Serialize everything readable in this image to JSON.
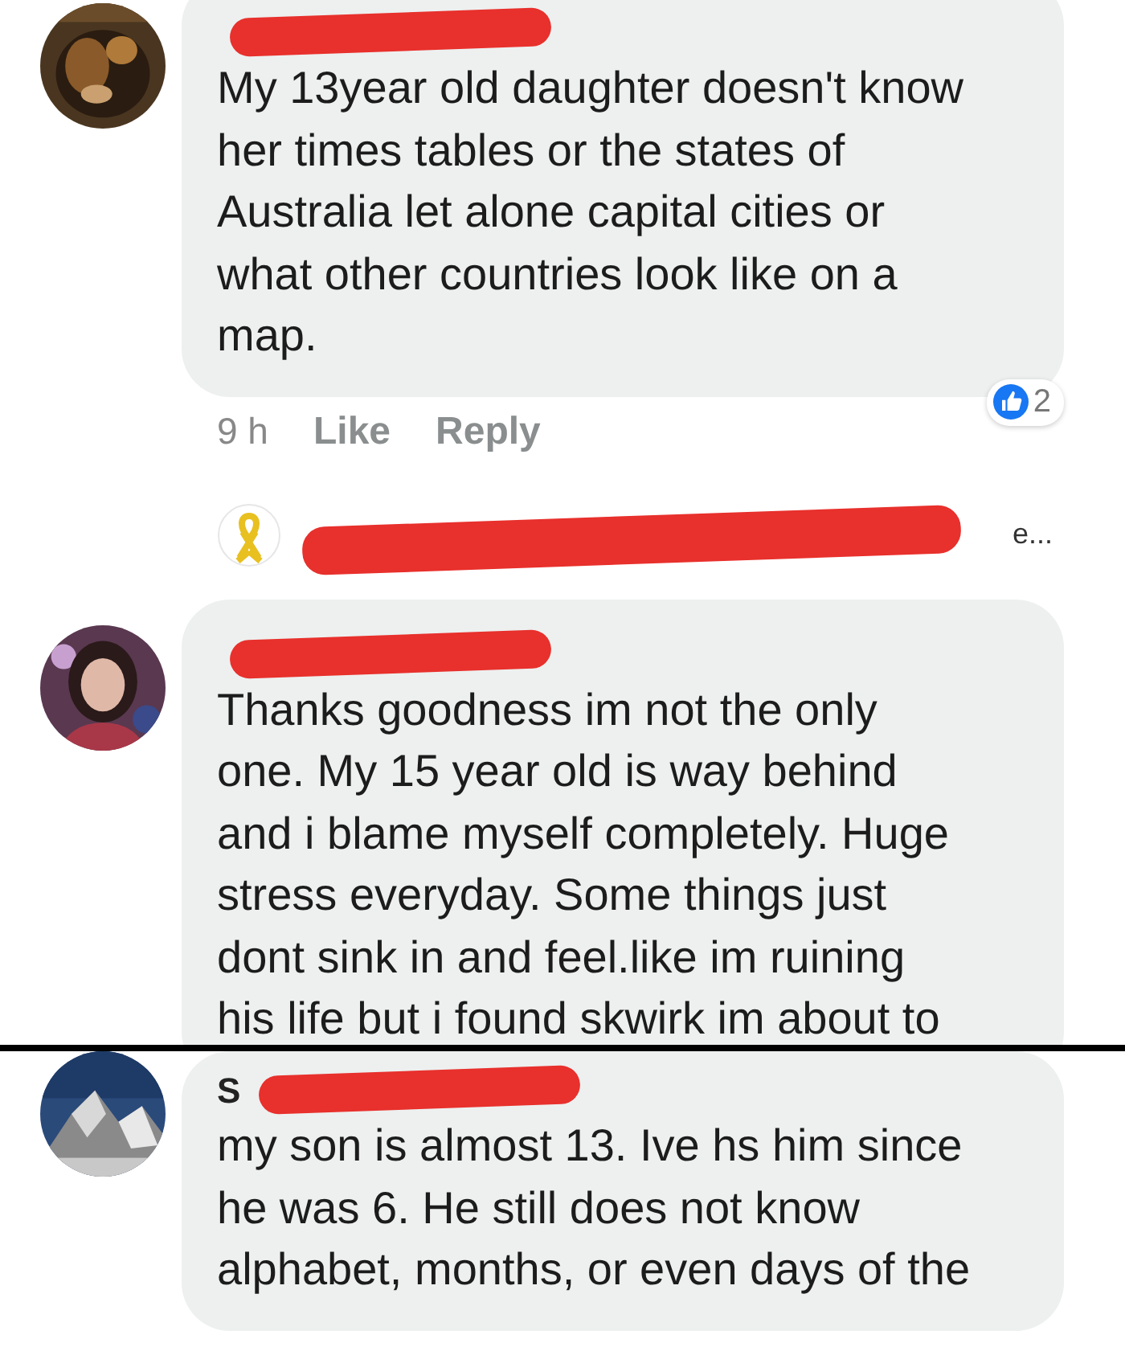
{
  "panels": [
    {
      "comments": [
        {
          "kind": "comment",
          "text": "My 13year old daughter doesn't know\nher times tables or the states of\nAustralia let alone capital cities or\nwhat other countries look like on a\nmap.",
          "meta": {
            "time": "9 h",
            "like": "Like",
            "reply": "Reply",
            "reactions": "2"
          },
          "reply_preview": {
            "text": "e..."
          }
        },
        {
          "kind": "comment",
          "text": "Thanks goodness im not the only\none. My 15 year old is way behind\nand i blame myself completely. Huge\nstress everyday. Some things just\ndont sink in and feel.like im ruining\nhis life but i found skwirk im about to"
        }
      ]
    },
    {
      "comments": [
        {
          "kind": "comment",
          "name": "S",
          "text": "my son is almost 13. Ive hs him since\nhe was 6. He still does not know\nalphabet, months, or even days of the"
        }
      ]
    }
  ]
}
